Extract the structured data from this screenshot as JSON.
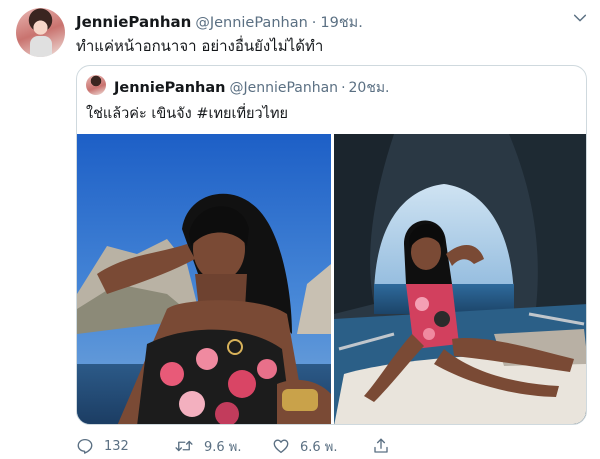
{
  "tweet": {
    "author_name": "JenniePanhan",
    "author_handle": "@JenniePanhan",
    "separator": "·",
    "time": "19ชม.",
    "text": "ทำแค่หน้าอกนาจา อย่างอื่นยังไม่ได้ทำ"
  },
  "quote": {
    "author_name": "JenniePanhan",
    "author_handle": "@JenniePanhan",
    "separator": "·",
    "time": "20ชม.",
    "text": "ใช่แล้วค่ะ เขินจัง #เทยเที่ยวไทย"
  },
  "actions": {
    "reply_count": "132",
    "retweet_count": "9.6 พ.",
    "like_count": "6.6 พ."
  },
  "colors": {
    "muted": "#5b7083",
    "border": "#cfd9de"
  },
  "icons": {
    "menu": "chevron-down-icon",
    "reply": "reply-icon",
    "retweet": "retweet-icon",
    "like": "heart-icon",
    "share": "share-icon"
  }
}
